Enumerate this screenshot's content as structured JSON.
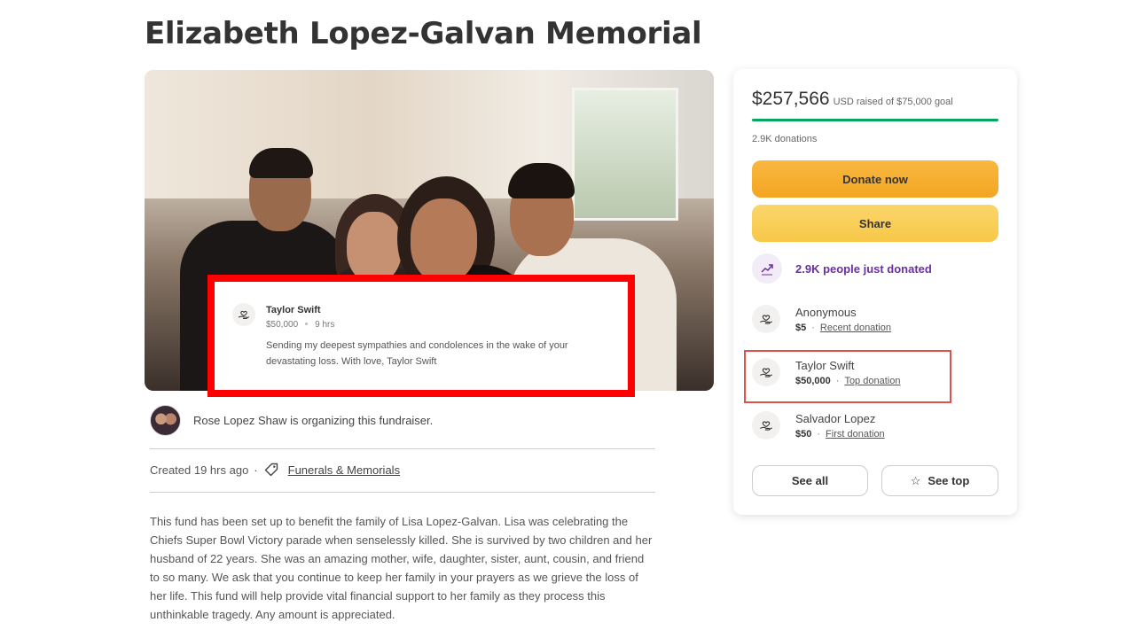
{
  "page": {
    "title": "Elizabeth Lopez-Galvan Memorial"
  },
  "overlay_donation": {
    "name": "Taylor Swift",
    "amount": "$50,000",
    "time": "9 hrs",
    "message": "Sending my deepest sympathies and condolences in the wake of your devastating loss. With love, Taylor Swift"
  },
  "organizer": {
    "text": "Rose Lopez Shaw is organizing this fundraiser."
  },
  "meta": {
    "created": "Created 19 hrs ago",
    "separator": "·",
    "category": "Funerals & Memorials"
  },
  "description": "This fund has been set up to benefit the family of Lisa Lopez-Galvan. Lisa was celebrating the Chiefs Super Bowl Victory parade when senselessly killed. She is survived by two children and her husband of 22 years. She was an amazing mother, wife, daughter, sister, aunt, cousin, and friend to so many. We ask that you continue to keep her family in your prayers as we grieve the loss of her life. This fund will help provide vital financial support to her family as they process this unthinkable tragedy. Any amount is appreciated.",
  "sidebar": {
    "amount_raised": "$257,566",
    "goal_text": "USD raised of $75,000 goal",
    "progress_fraction": 1.0,
    "donations_count": "2.9K donations",
    "donate_label": "Donate now",
    "share_label": "Share",
    "trend_text": "2.9K people just donated",
    "donors": [
      {
        "name": "Anonymous",
        "amount": "$5",
        "tag": "Recent donation"
      },
      {
        "name": "Taylor Swift",
        "amount": "$50,000",
        "tag": "Top donation"
      },
      {
        "name": "Salvador Lopez",
        "amount": "$50",
        "tag": "First donation"
      }
    ],
    "see_all_label": "See all",
    "see_top_label": "See top",
    "colors": {
      "progress": "#02a95c",
      "donate": "#f3a521",
      "share": "#f7c848",
      "trend": "#6b2fa1",
      "highlight": "#ff0000"
    }
  }
}
